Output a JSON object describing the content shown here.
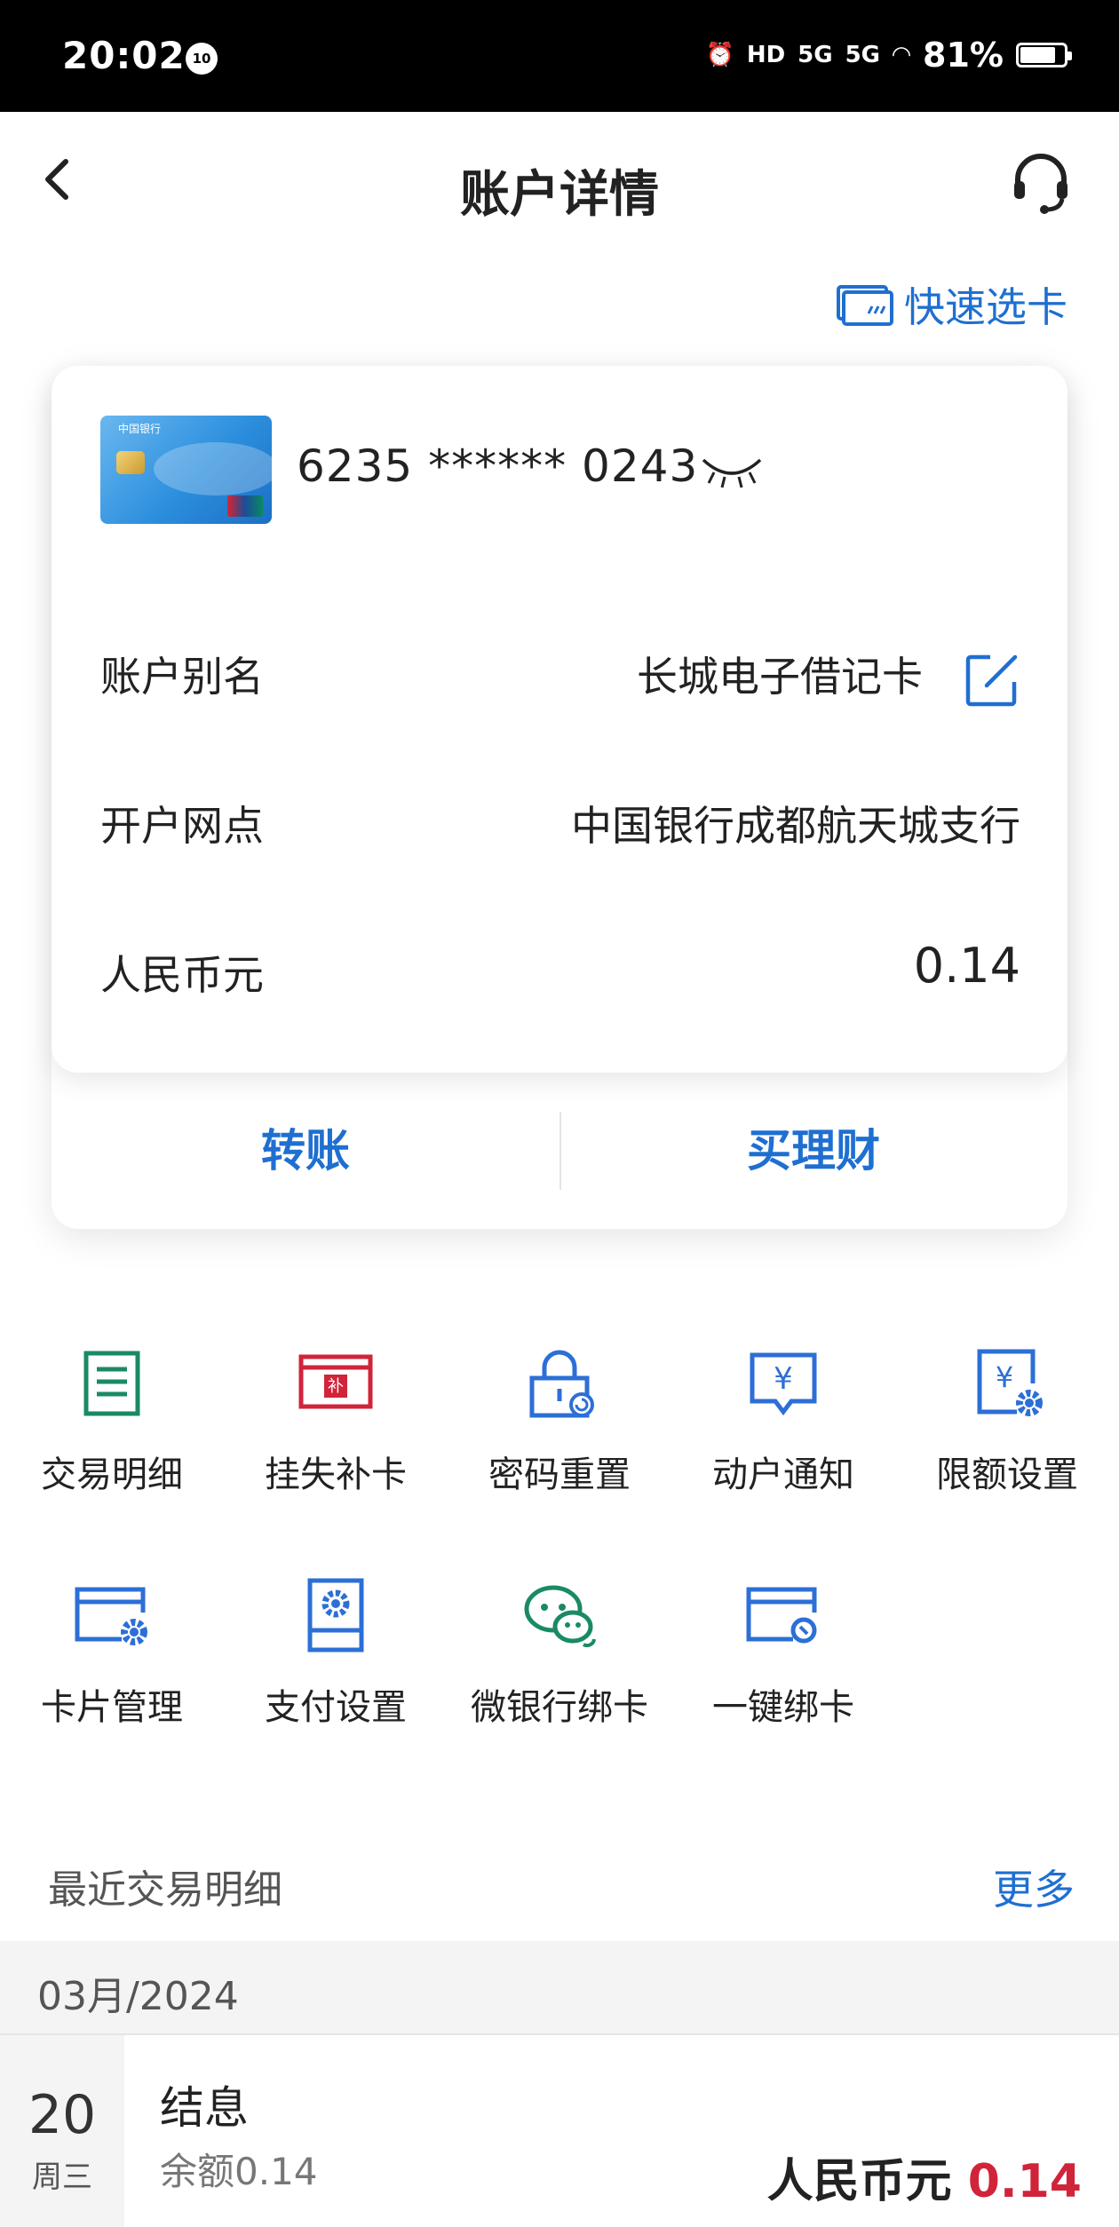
{
  "status_bar": {
    "time": "20:02",
    "badge": "10",
    "network1": "HD",
    "network2": "5G",
    "network3": "5G",
    "battery": "81%",
    "battery_level": 0.81
  },
  "nav": {
    "title": "账户详情"
  },
  "quick_select": {
    "label": "快速选卡"
  },
  "account": {
    "card_number": "6235 ****** 0243",
    "bank_card_text": "中国银行",
    "rows": [
      {
        "label": "账户别名",
        "value": "长城电子借记卡"
      },
      {
        "label": "开户网点",
        "value": "中国银行成都航天城支行"
      },
      {
        "label": "人民币元",
        "value": "0.14"
      }
    ],
    "actions": [
      {
        "label": "转账"
      },
      {
        "label": "买理财"
      }
    ]
  },
  "functions": [
    {
      "label": "交易明细",
      "icon": "document-list-icon",
      "color": "#1a8a63"
    },
    {
      "label": "挂失补卡",
      "icon": "card-report-icon",
      "color": "#d0243a"
    },
    {
      "label": "密码重置",
      "icon": "lock-reset-icon",
      "color": "#2c6fd6"
    },
    {
      "label": "动户通知",
      "icon": "yuan-message-icon",
      "color": "#2c6fd6"
    },
    {
      "label": "限额设置",
      "icon": "yuan-settings-icon",
      "color": "#2c6fd6"
    },
    {
      "label": "卡片管理",
      "icon": "card-gear-icon",
      "color": "#2c6fd6"
    },
    {
      "label": "支付设置",
      "icon": "pay-settings-icon",
      "color": "#2c6fd6"
    },
    {
      "label": "微银行绑卡",
      "icon": "wechat-bind-icon",
      "color": "#1a8a63"
    },
    {
      "label": "一键绑卡",
      "icon": "card-bind-icon",
      "color": "#2c6fd6"
    }
  ],
  "recent": {
    "title": "最近交易明细",
    "more": "更多",
    "month": "03月/2024",
    "transactions": [
      {
        "day": "20",
        "weekday": "周三",
        "name": "结息",
        "balance": "余额0.14",
        "currency": "人民币元",
        "amount": "0.14"
      }
    ]
  }
}
